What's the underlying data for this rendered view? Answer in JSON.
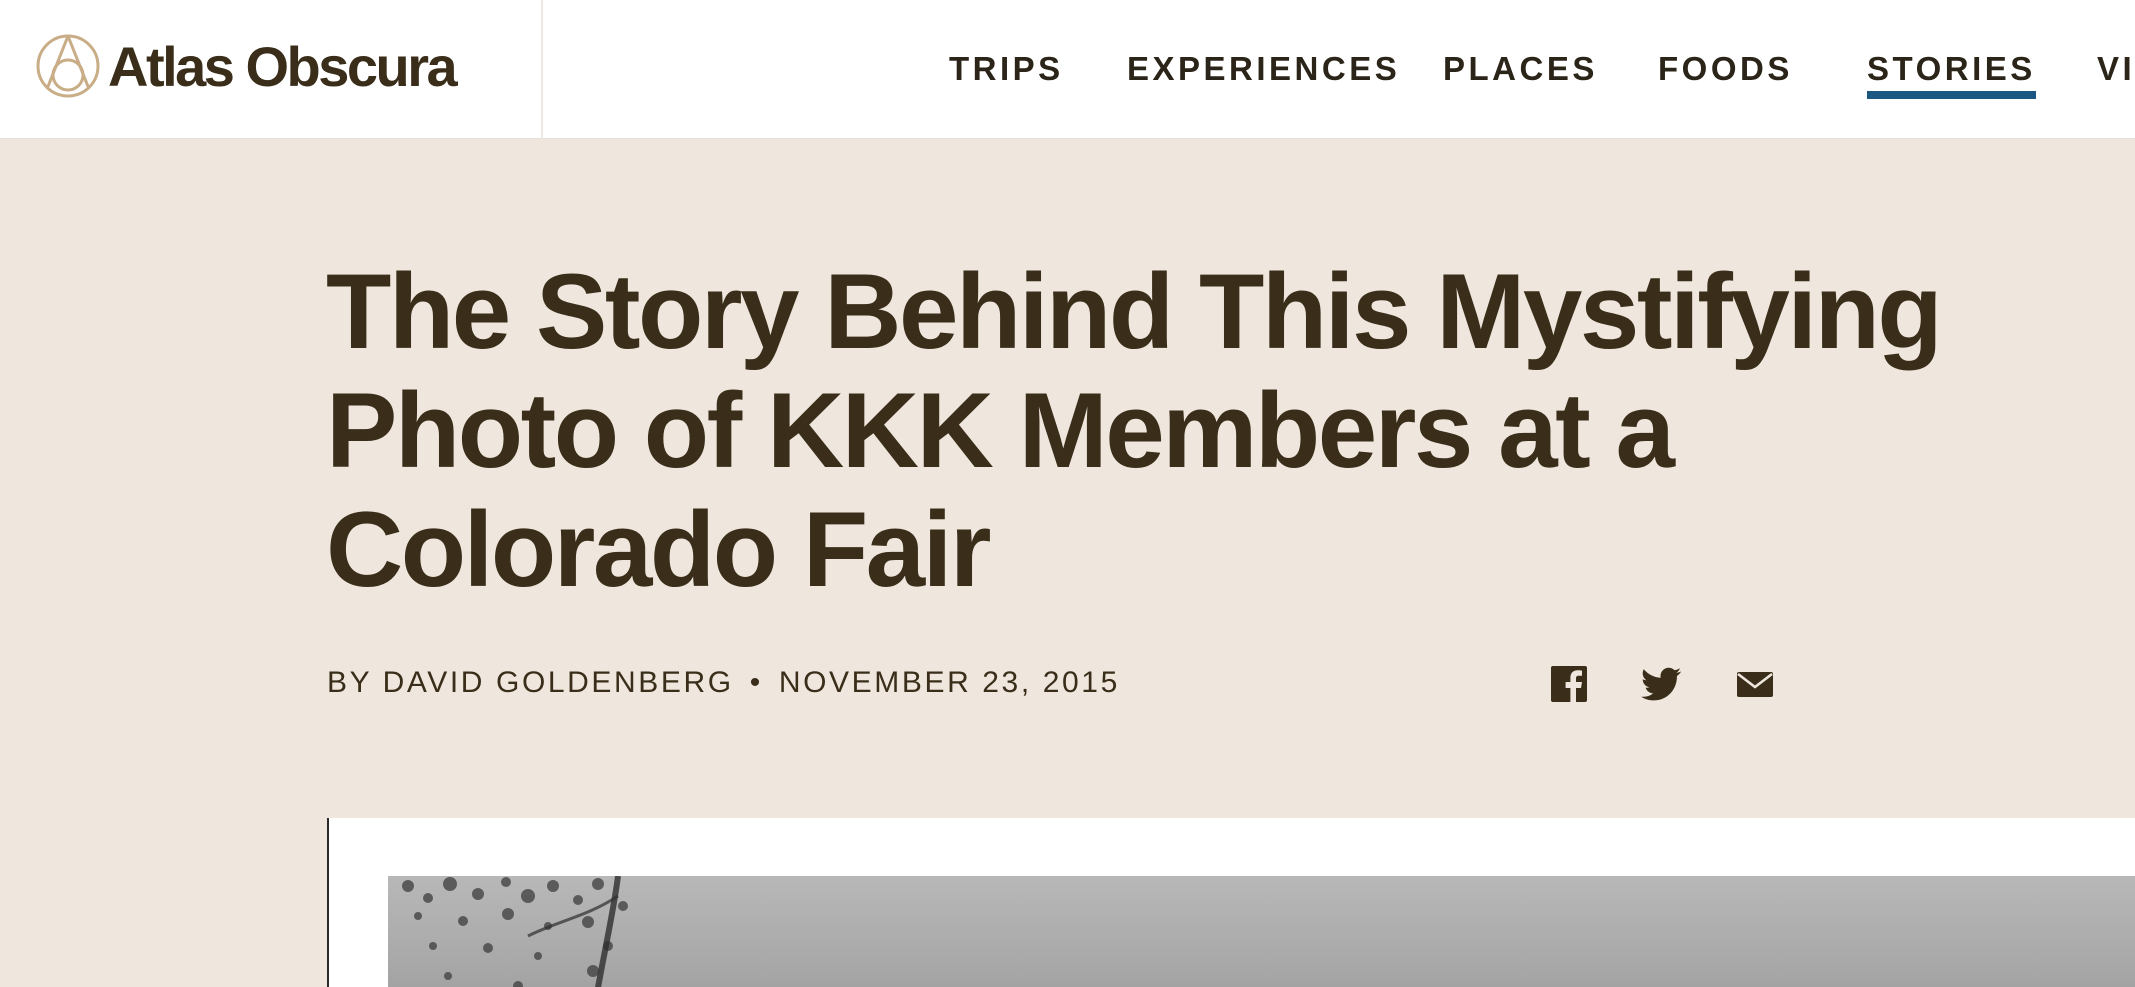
{
  "site": {
    "name": "Atlas Obscura",
    "logo_icon": "atlas-compass-logo-icon"
  },
  "nav": {
    "items": [
      {
        "label": "TRIPS",
        "active": false
      },
      {
        "label": "EXPERIENCES",
        "active": false
      },
      {
        "label": "PLACES",
        "active": false
      },
      {
        "label": "FOODS",
        "active": false
      },
      {
        "label": "STORIES",
        "active": true
      },
      {
        "label": "VI",
        "active": false
      }
    ],
    "active_underline_color": "#1c5783"
  },
  "article": {
    "title": "The Story Behind This Mystifying Photo of KKK Members at a Colorado Fair",
    "byline": "BY DAVID GOLDENBERG",
    "separator": "•",
    "date": "NOVEMBER 23, 2015"
  },
  "share": {
    "icons": [
      "facebook-icon",
      "twitter-icon",
      "email-icon"
    ]
  },
  "colors": {
    "page_background": "#efe7dd",
    "text": "#3a2e1a",
    "logo_mark": "#c8ad86"
  }
}
